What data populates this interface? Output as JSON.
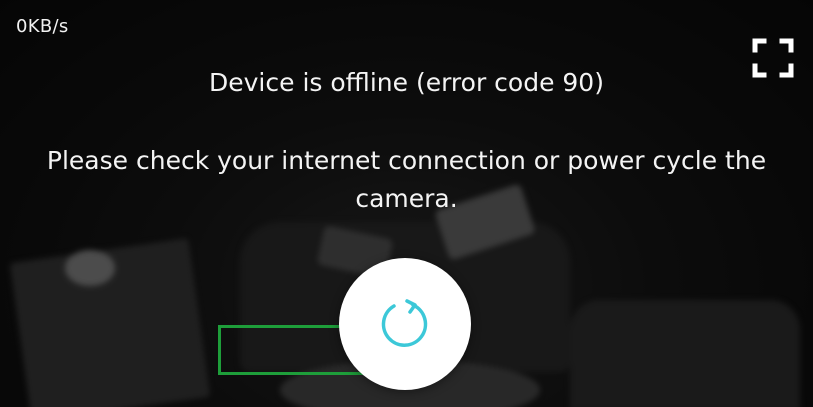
{
  "stream": {
    "bitrate": "0KB/s"
  },
  "status": {
    "title": "Device is offline (error code 90)",
    "message": "Please check your internet connection or power cycle the camera."
  },
  "controls": {
    "fullscreen_icon": "fullscreen-icon",
    "refresh_icon": "refresh-icon"
  },
  "colors": {
    "accent": "#3cc8d8",
    "detection_box": "#1e9e3a",
    "text": "#f4f4f4"
  }
}
